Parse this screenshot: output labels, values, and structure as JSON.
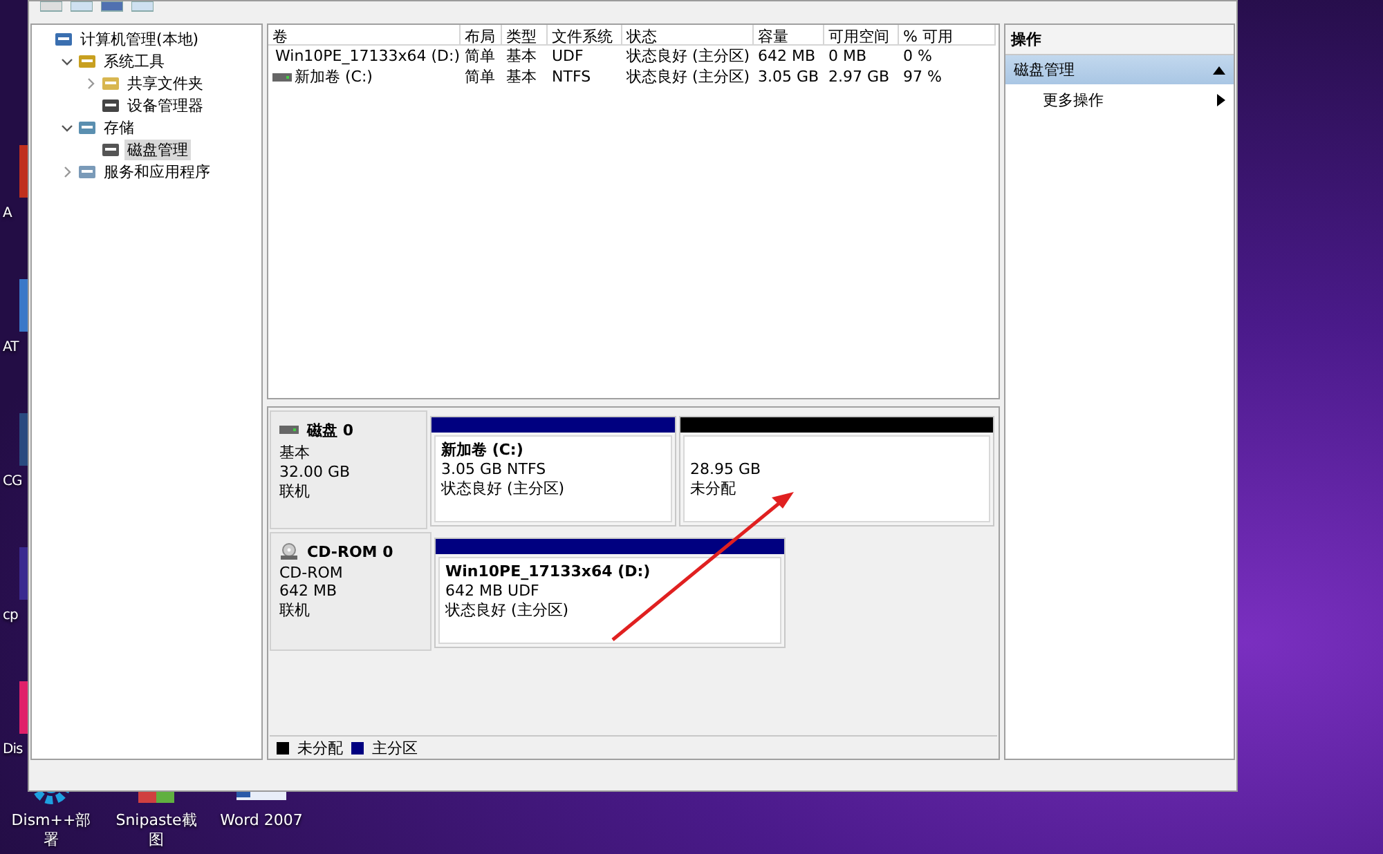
{
  "desktop": {
    "side_icons": [
      {
        "label": "A",
        "color": "#c0301e"
      },
      {
        "label": "AT",
        "color": "#3a78c8"
      },
      {
        "label": "CG",
        "color": "#2a4a80"
      },
      {
        "label": "cp",
        "color": "#3a2a90"
      },
      {
        "label": "Dis",
        "color": "#e0206a"
      }
    ],
    "bottom_icons": [
      {
        "label": "Dism++部署",
        "kind": "gear"
      },
      {
        "label": "Snipaste截图",
        "kind": "snip"
      },
      {
        "label": "Word 2007",
        "kind": "doc"
      }
    ]
  },
  "tree": [
    {
      "label": "计算机管理(本地)",
      "kind": "computer",
      "selected": false,
      "children": [
        {
          "label": "系统工具",
          "kind": "tools",
          "expanded": true,
          "selected": false,
          "children": [
            {
              "label": "共享文件夹",
              "kind": "folder",
              "expanded": false,
              "selected": false
            },
            {
              "label": "设备管理器",
              "kind": "device",
              "selected": false
            }
          ]
        },
        {
          "label": "存储",
          "kind": "storage",
          "expanded": true,
          "selected": false,
          "children": [
            {
              "label": "磁盘管理",
              "kind": "disk",
              "selected": true
            }
          ]
        },
        {
          "label": "服务和应用程序",
          "kind": "services",
          "expanded": false,
          "selected": false
        }
      ]
    }
  ],
  "volumes": {
    "columns": [
      "卷",
      "布局",
      "类型",
      "文件系统",
      "状态",
      "容量",
      "可用空间",
      "% 可用"
    ],
    "rows": [
      {
        "kind": "cd",
        "cells": [
          "Win10PE_17133x64 (D:)",
          "简单",
          "基本",
          "UDF",
          "状态良好 (主分区)",
          "642 MB",
          "0 MB",
          "0 %"
        ]
      },
      {
        "kind": "disk",
        "cells": [
          "新加卷 (C:)",
          "简单",
          "基本",
          "NTFS",
          "状态良好 (主分区)",
          "3.05 GB",
          "2.97 GB",
          "97 %"
        ]
      }
    ]
  },
  "disks": [
    {
      "kind": "disk",
      "name": "磁盘 0",
      "type": "基本",
      "size": "32.00 GB",
      "status": "联机",
      "partitions": [
        {
          "name": "新加卷  (C:)",
          "detail": "3.05 GB NTFS",
          "status": "状态良好 (主分区)",
          "color": "#000080"
        },
        {
          "detail": "28.95 GB",
          "status": "未分配",
          "color": "#000000"
        }
      ]
    },
    {
      "kind": "cdrom",
      "name": "CD-ROM 0",
      "type": "CD-ROM",
      "size": "642 MB",
      "status": "联机",
      "partitions": [
        {
          "name": "Win10PE_17133x64  (D:)",
          "detail": "642 MB UDF",
          "status": "状态良好 (主分区)",
          "color": "#000080"
        }
      ]
    }
  ],
  "legend": [
    {
      "label": "未分配",
      "color": "#000000"
    },
    {
      "label": "主分区",
      "color": "#000080"
    }
  ],
  "actions": {
    "title": "操作",
    "section": {
      "label": "磁盘管理",
      "expanded": true
    },
    "items": [
      {
        "label": "更多操作"
      }
    ]
  }
}
